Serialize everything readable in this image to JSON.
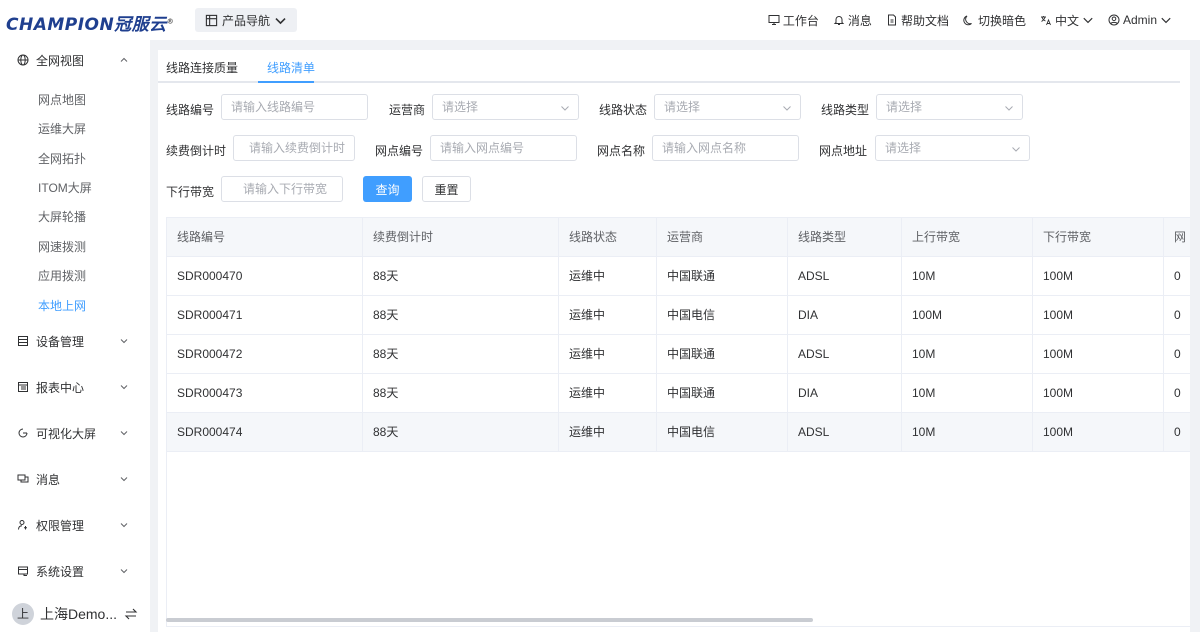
{
  "brand": {
    "logo_text": "CHAMPION冠服云",
    "reg_mark": "®"
  },
  "header": {
    "product_nav": "产品导航",
    "actions": [
      {
        "label": "工作台",
        "icon": "workbench-icon"
      },
      {
        "label": "消息",
        "icon": "bell-icon"
      },
      {
        "label": "帮助文档",
        "icon": "document-icon"
      },
      {
        "label": "切换暗色",
        "icon": "moon-icon"
      },
      {
        "label": "中文",
        "icon": "translate-icon"
      },
      {
        "label": "Admin",
        "icon": "user-circle-icon"
      }
    ]
  },
  "sidebar": {
    "groups": [
      {
        "label": "全网视图",
        "icon": "globe-icon",
        "expanded": true
      },
      {
        "label": "设备管理",
        "icon": "device-icon",
        "expanded": false
      },
      {
        "label": "报表中心",
        "icon": "report-icon",
        "expanded": false
      },
      {
        "label": "可视化大屏",
        "icon": "screen-icon",
        "expanded": false
      },
      {
        "label": "消息",
        "icon": "message-icon",
        "expanded": false
      },
      {
        "label": "权限管理",
        "icon": "permission-icon",
        "expanded": false
      },
      {
        "label": "系统设置",
        "icon": "settings-icon",
        "expanded": false
      }
    ],
    "sub_items": [
      "网点地图",
      "运维大屏",
      "全网拓扑",
      "ITOM大屏",
      "大屏轮播",
      "网速拨测",
      "应用拨测",
      "本地上网"
    ],
    "active_sub": "本地上网",
    "user": {
      "avatar": "上",
      "name": "上海Demo..."
    }
  },
  "tabs": [
    "线路连接质量",
    "线路清单"
  ],
  "active_tab": "线路清单",
  "filters": {
    "line_no": {
      "label": "线路编号",
      "placeholder": "请输入线路编号"
    },
    "carrier": {
      "label": "运营商",
      "placeholder": "请选择"
    },
    "status": {
      "label": "线路状态",
      "placeholder": "请选择"
    },
    "type": {
      "label": "线路类型",
      "placeholder": "请选择"
    },
    "renew": {
      "label": "续费倒计时",
      "placeholder": "请输入续费倒计时"
    },
    "site_no": {
      "label": "网点编号",
      "placeholder": "请输入网点编号"
    },
    "site_name": {
      "label": "网点名称",
      "placeholder": "请输入网点名称"
    },
    "site_addr": {
      "label": "网点地址",
      "placeholder": "请选择"
    },
    "down_bw": {
      "label": "下行带宽",
      "placeholder": "请输入下行带宽"
    },
    "query_button": "查询",
    "reset_button": "重置"
  },
  "table": {
    "columns": [
      "线路编号",
      "续费倒计时",
      "线路状态",
      "运营商",
      "线路类型",
      "上行带宽",
      "下行带宽",
      "网"
    ],
    "rows": [
      [
        "SDR000470",
        "88天",
        "运维中",
        "中国联通",
        "ADSL",
        "10M",
        "100M",
        "0"
      ],
      [
        "SDR000471",
        "88天",
        "运维中",
        "中国电信",
        "DIA",
        "100M",
        "100M",
        "0"
      ],
      [
        "SDR000472",
        "88天",
        "运维中",
        "中国联通",
        "ADSL",
        "10M",
        "100M",
        "0"
      ],
      [
        "SDR000473",
        "88天",
        "运维中",
        "中国联通",
        "DIA",
        "10M",
        "100M",
        "0"
      ],
      [
        "SDR000474",
        "88天",
        "运维中",
        "中国电信",
        "ADSL",
        "10M",
        "100M",
        "0"
      ]
    ],
    "hover_row": 4
  },
  "colors": {
    "primary": "#409eff",
    "logo": "#1f3f8f",
    "text": "#303133",
    "border": "#dcdfe6"
  }
}
